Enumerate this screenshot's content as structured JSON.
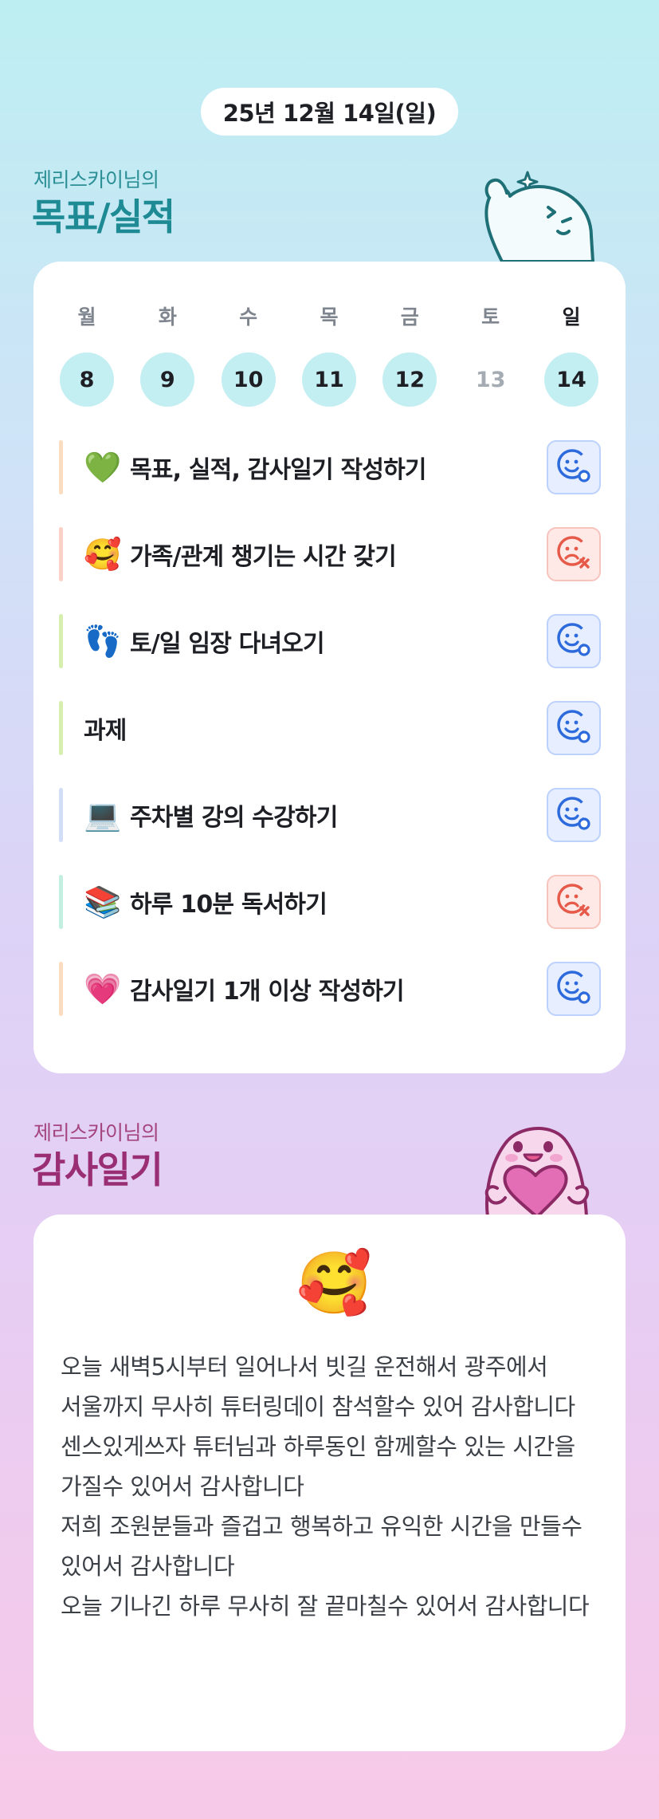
{
  "date": "25년 12월 14일(일)",
  "goals_section": {
    "subtitle": "제리스카이님의",
    "title": "목표/실적"
  },
  "week": [
    {
      "label": "월",
      "day": "8",
      "filled": true
    },
    {
      "label": "화",
      "day": "9",
      "filled": true
    },
    {
      "label": "수",
      "day": "10",
      "filled": true
    },
    {
      "label": "목",
      "day": "11",
      "filled": true
    },
    {
      "label": "금",
      "day": "12",
      "filled": true
    },
    {
      "label": "토",
      "day": "13",
      "filled": false
    },
    {
      "label": "일",
      "day": "14",
      "filled": true
    }
  ],
  "goals": [
    {
      "emoji": "💚",
      "text": "목표, 실적, 감사일기 작성하기",
      "status": "done",
      "bar_color": "#fbdcc0"
    },
    {
      "emoji": "🥰",
      "text": "가족/관계 챙기는 시간 갖기",
      "status": "missed",
      "bar_color": "#fbd0c7"
    },
    {
      "emoji": "👣",
      "text": "토/일 임장 다녀오기",
      "status": "done",
      "bar_color": "#d6efae"
    },
    {
      "emoji": "",
      "text": "과제",
      "status": "done",
      "bar_color": "#d6efae"
    },
    {
      "emoji": "💻",
      "text": "주차별 강의 수강하기",
      "status": "done",
      "bar_color": "#d2def7"
    },
    {
      "emoji": "📚",
      "text": "하루 10분 독서하기",
      "status": "missed",
      "bar_color": "#c3efe0"
    },
    {
      "emoji": "💗",
      "text": "감사일기 1개 이상 작성하기",
      "status": "done",
      "bar_color": "#fbdcc0"
    }
  ],
  "diary_section": {
    "subtitle": "제리스카이님의",
    "title": "감사일기",
    "emoji": "🥰",
    "text": "오늘 새벽5시부터 일어나서 빗길 운전해서 광주에서 서울까지 무사히 튜터링데이 참석할수 있어 감사합니다\n센스있게쓰자 튜터님과 하루동인 함께할수 있는 시간을 가질수 있어서 감사합니다\n저희 조원분들과 즐겁고 행복하고 유익한 시간을 만들수 있어서 감사합니다\n오늘 기나긴 하루 무사히 잘 끝마칠수 있어서 감사합니다"
  },
  "colors": {
    "done": "#2d6bdc",
    "missed": "#e65a4a",
    "teal": "#1e8a94",
    "plum": "#9a2e74"
  },
  "icons": {
    "done": "smiley-check-icon",
    "missed": "sad-x-icon",
    "goals_mascot": "white-mascot-waving-icon",
    "diary_mascot": "pink-mascot-heart-icon"
  }
}
